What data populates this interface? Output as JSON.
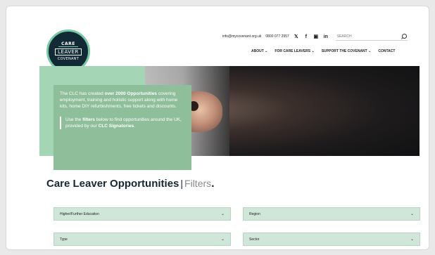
{
  "logo": {
    "line1": "CARE",
    "line2": "LEAVER",
    "line3": "COVENANT"
  },
  "topbar": {
    "email": "info@mycovenant.org.uk",
    "phone": "0800 077 2957",
    "search_placeholder": "SEARCH",
    "icons": [
      "twitter-icon",
      "facebook-icon",
      "instagram-icon",
      "linkedin-icon",
      "search-icon"
    ]
  },
  "nav": {
    "about": "ABOUT",
    "care_leavers": "FOR CARE LEAVERS",
    "support": "SUPPORT THE COVENANT",
    "contact": "CONTACT"
  },
  "hero": {
    "p1_start": "The CLC has created ",
    "p1_bold": "over 2000 Opportunities",
    "p1_end": " covering employment, training and holistic support along with home kits, home DIY refurbishments, free tickets and discounts.",
    "p2_start": "Use the ",
    "p2_bold1": "filters",
    "p2_mid": " below to find opportunities around the UK, provided by our ",
    "p2_bold2": "CLC Signatories",
    "p2_end": "."
  },
  "opportunities": {
    "title": "Care Leaver Opportunities",
    "sep": "|",
    "filters_word": "Filters",
    "dot": "."
  },
  "filters": [
    {
      "label": "Higher/Further Education"
    },
    {
      "label": "Region"
    },
    {
      "label": "Type"
    },
    {
      "label": "Sector"
    }
  ],
  "colors": {
    "accent_green": "#a4d6b6",
    "navy": "#122a36",
    "filter_bg": "#d0e6d9"
  }
}
